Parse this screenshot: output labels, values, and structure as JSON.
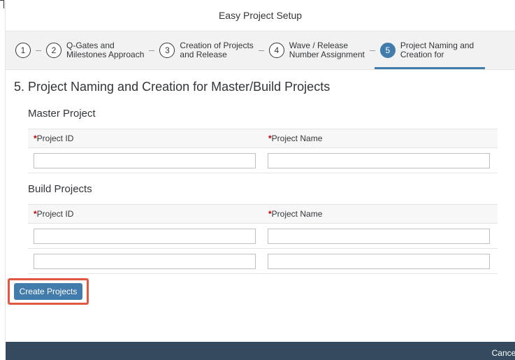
{
  "dialog": {
    "title": "Easy Project Setup",
    "cancel_label": "Cancel"
  },
  "steps": [
    {
      "number": "1",
      "label": ""
    },
    {
      "number": "2",
      "label": "Q-Gates and\nMilestones Approach"
    },
    {
      "number": "3",
      "label": "Creation of Projects\nand Release"
    },
    {
      "number": "4",
      "label": "Wave / Release\nNumber Assignment"
    },
    {
      "number": "5",
      "label": "Project Naming and\nCreation for",
      "active": true
    }
  ],
  "section": {
    "title": "5. Project Naming and Creation for Master/Build Projects"
  },
  "master": {
    "title": "Master Project",
    "col_id": "Project ID",
    "col_name": "Project Name",
    "rows": [
      {
        "id": "",
        "name": ""
      }
    ]
  },
  "build": {
    "title": "Build Projects",
    "col_id": "Project ID",
    "col_name": "Project Name",
    "rows": [
      {
        "id": "",
        "name": ""
      },
      {
        "id": "",
        "name": ""
      }
    ]
  },
  "actions": {
    "create_label": "Create Projects"
  },
  "colors": {
    "accent": "#427cac",
    "highlight": "#e1573f",
    "footer": "#354a5f",
    "required": "#bb0000"
  }
}
